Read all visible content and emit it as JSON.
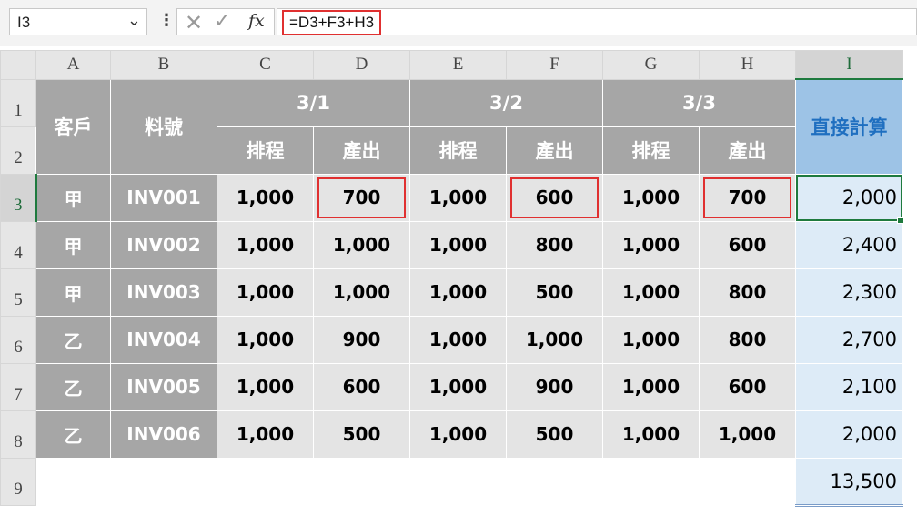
{
  "formula_bar": {
    "name_box": "I3",
    "formula": "=D3+F3+H3",
    "fx_label": "fx"
  },
  "columns": [
    "A",
    "B",
    "C",
    "D",
    "E",
    "F",
    "G",
    "H",
    "I"
  ],
  "row_numbers": [
    "1",
    "2",
    "3",
    "4",
    "5",
    "6",
    "7",
    "8",
    "9"
  ],
  "headers": {
    "customer": "客戶",
    "part_no": "料號",
    "dates": [
      "3/1",
      "3/2",
      "3/3"
    ],
    "schedule": "排程",
    "output": "產出",
    "total": "直接計算"
  },
  "rows": [
    {
      "customer": "甲",
      "part": "INV001",
      "values": [
        "1,000",
        "700",
        "1,000",
        "600",
        "1,000",
        "700"
      ],
      "total": "2,000"
    },
    {
      "customer": "甲",
      "part": "INV002",
      "values": [
        "1,000",
        "1,000",
        "1,000",
        "800",
        "1,000",
        "600"
      ],
      "total": "2,400"
    },
    {
      "customer": "甲",
      "part": "INV003",
      "values": [
        "1,000",
        "1,000",
        "1,000",
        "500",
        "1,000",
        "800"
      ],
      "total": "2,300"
    },
    {
      "customer": "乙",
      "part": "INV004",
      "values": [
        "1,000",
        "900",
        "1,000",
        "1,000",
        "1,000",
        "800"
      ],
      "total": "2,700"
    },
    {
      "customer": "乙",
      "part": "INV005",
      "values": [
        "1,000",
        "600",
        "1,000",
        "900",
        "1,000",
        "600"
      ],
      "total": "2,100"
    },
    {
      "customer": "乙",
      "part": "INV006",
      "values": [
        "1,000",
        "500",
        "1,000",
        "500",
        "1,000",
        "1,000"
      ],
      "total": "2,000"
    }
  ],
  "grand_total": "13,500",
  "colors": {
    "header_gray": "#a6a6a6",
    "data_gray": "#e4e4e4",
    "total_header": "#9dc3e6",
    "total_cell": "#ddebf7",
    "highlight": "#e03030",
    "selection": "#1e7a3e"
  }
}
